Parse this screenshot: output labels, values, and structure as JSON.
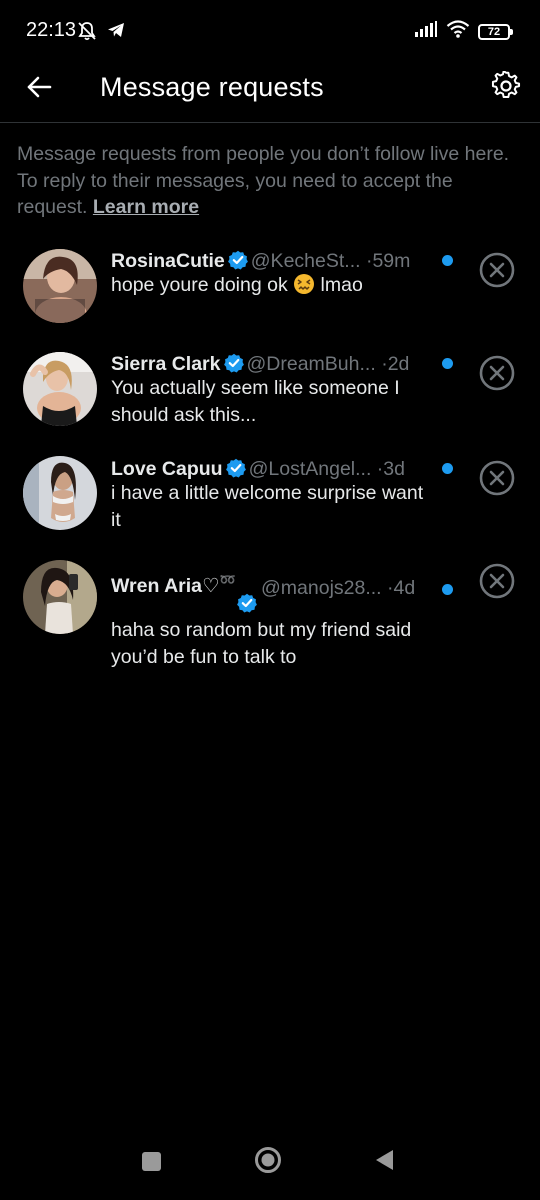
{
  "status_bar": {
    "time": "22:13",
    "battery": "72",
    "icons": [
      "mute-icon",
      "telegram-icon",
      "signal-icon",
      "wifi-icon",
      "battery-icon"
    ]
  },
  "header": {
    "title": "Message requests",
    "back_icon": "arrow-left-icon",
    "settings_icon": "gear-icon"
  },
  "intro": {
    "text": "Message requests from people you don’t follow live here. To reply to their messages, you need to accept the request. ",
    "link": "Learn more"
  },
  "requests": [
    {
      "name": "RosinaCutie",
      "handle": "@KecheSt...",
      "time": "59m",
      "verified": true,
      "unread": true,
      "preview_before": "hope youre doing ok ",
      "preview_emoji": "confounded-face",
      "preview_after": " lmao"
    },
    {
      "name": "Sierra Clark",
      "handle": "@DreamBuh...",
      "time": "2d",
      "verified": true,
      "unread": true,
      "preview": "You actually seem like someone I should ask this..."
    },
    {
      "name": "Love Capuu",
      "handle": "@LostAngel...",
      "time": "3d",
      "verified": true,
      "unread": true,
      "preview": "i have a little welcome surprise want it"
    },
    {
      "name": "Wren Aria♡",
      "name_glyph": "➿",
      "handle": "@manojs28...",
      "time": "4d",
      "verified": true,
      "unread": true,
      "preview": "haha so random but my friend said you’d be fun to talk to"
    }
  ],
  "separator": "·",
  "colors": {
    "background": "#000000",
    "text_primary": "#e7e9ea",
    "text_secondary": "#71767b",
    "accent": "#1d9bf0",
    "divider": "#2f3336"
  },
  "nav_bar": {
    "icons": [
      "recent-apps-icon",
      "home-circle-icon",
      "back-triangle-icon"
    ]
  }
}
